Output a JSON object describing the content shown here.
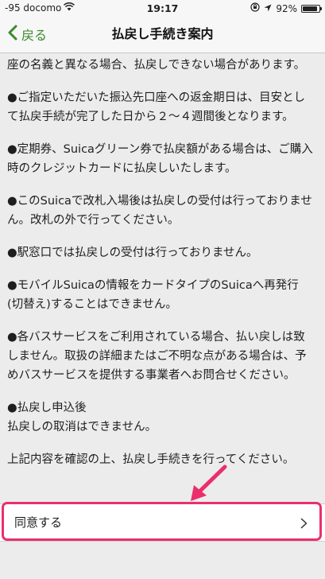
{
  "status_bar": {
    "carrier": "-95 docomo",
    "time": "19:17",
    "battery": "92%",
    "battery_level": 0.92,
    "icons": [
      "wifi-icon",
      "lock-rotation-icon",
      "location-icon",
      "battery-icon"
    ]
  },
  "nav": {
    "back_label": "戻る",
    "title": "払戻し手続き案内"
  },
  "content": {
    "paragraphs": [
      "座の名義と異なる場合、払戻しできない場合があります。",
      "●ご指定いただいた振込先口座への返金期日は、目安として払戻手続が完了した日から２～４週間後となります。",
      "●定期券、Suicaグリーン券で払戻額がある場合は、ご購入時のクレジットカードに払戻しいたします。",
      "●このSuicaで改札入場後は払戻しの受付は行っておりません。改札の外で行ってください。",
      "●駅窓口では払戻しの受付は行っておりません。",
      "●モバイルSuicaの情報をカードタイプのSuicaへ再発行(切替え)することはできません。",
      "●各バスサービスをご利用されている場合、払い戻しは致しません。取扱の詳細またはご不明な点がある場合は、予めバスサービスを提供する事業者へお問合せください。",
      "●払戻し申込後\n払戻しの取消はできません。",
      "上記内容を確認の上、払戻し手続きを行ってください。"
    ]
  },
  "agree": {
    "label": "同意する"
  },
  "colors": {
    "accent": "#3a8a2a",
    "highlight": "#ea2f6c",
    "background": "#ececec"
  }
}
